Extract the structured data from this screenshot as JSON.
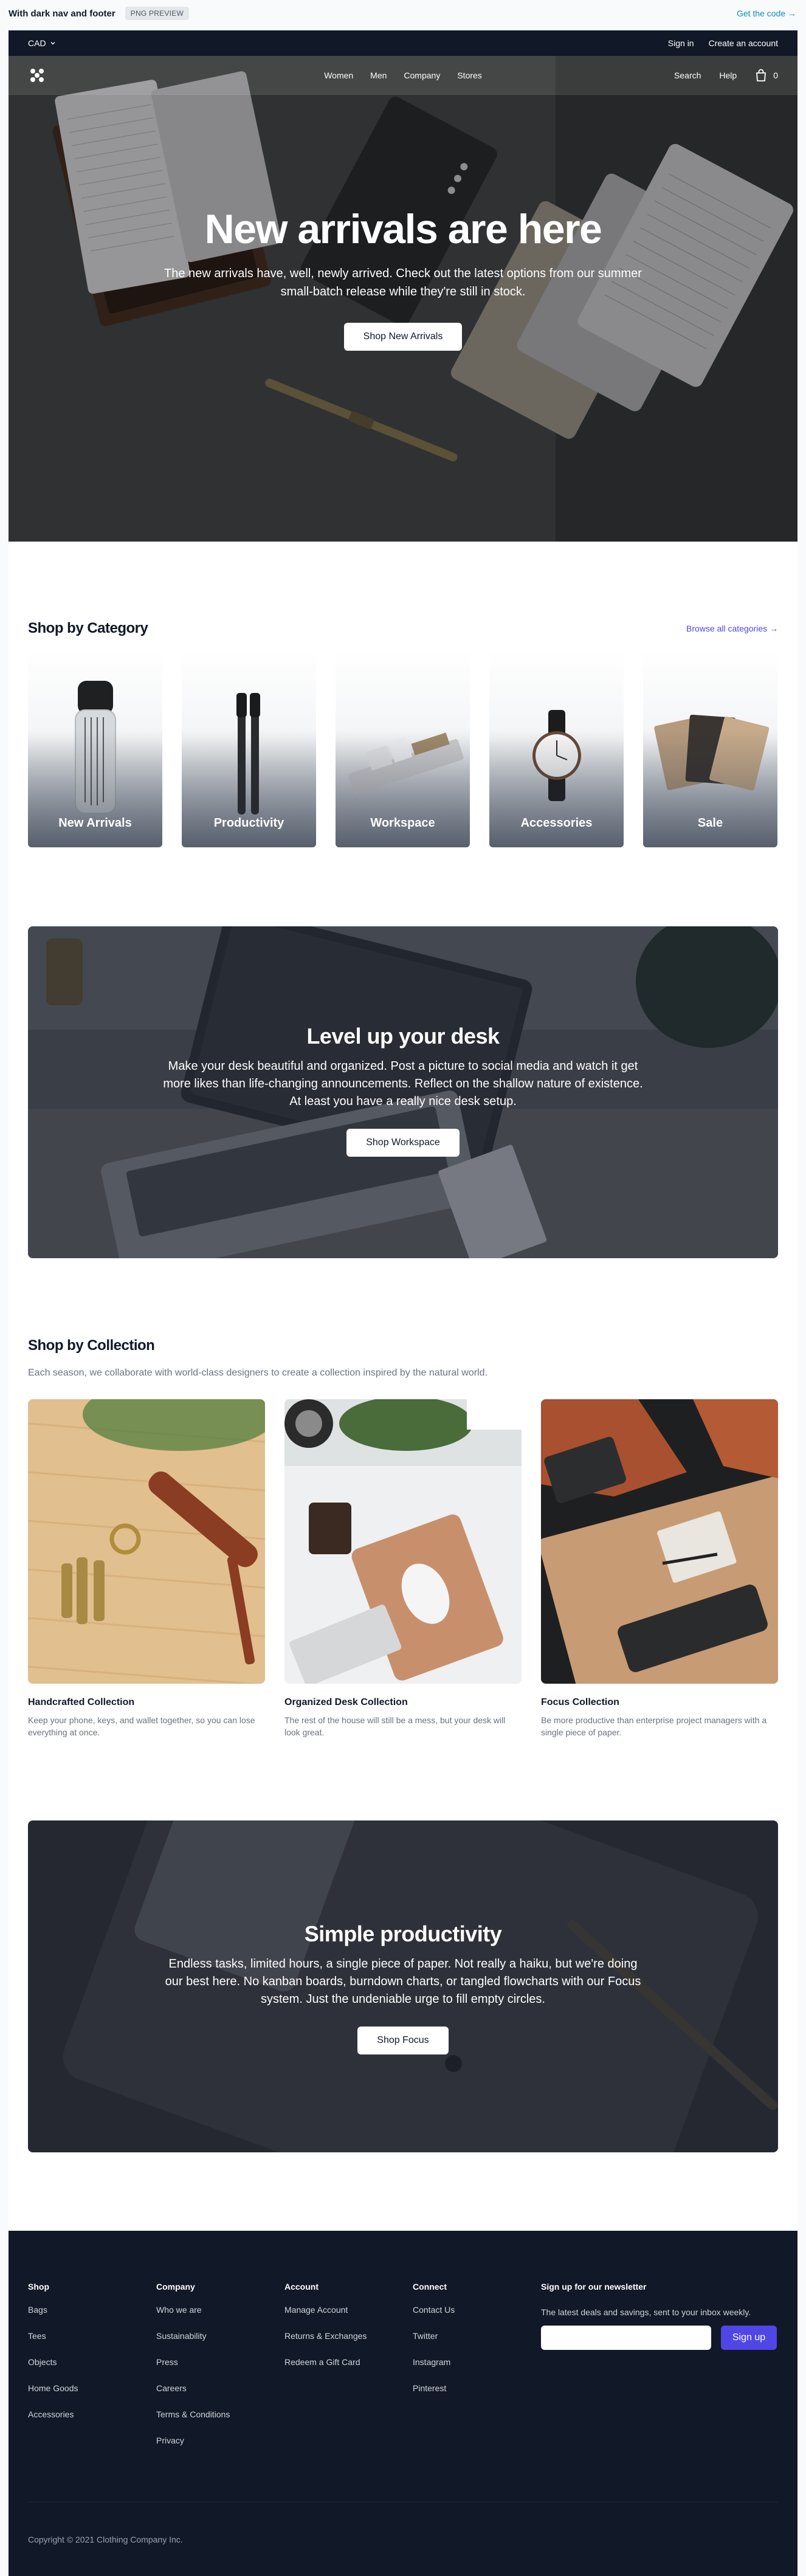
{
  "preview": {
    "title": "With dark nav and footer",
    "badge": "PNG PREVIEW",
    "get_code": "Get the code →"
  },
  "topbar": {
    "currency": "CAD",
    "sign_in": "Sign in",
    "create_account": "Create an account"
  },
  "nav": {
    "links": [
      "Women",
      "Men",
      "Company",
      "Stores"
    ],
    "search": "Search",
    "help": "Help",
    "cart_count": "0"
  },
  "hero": {
    "title": "New arrivals are here",
    "subtitle": "The new arrivals have, well, newly arrived. Check out the latest options from our summer small-batch release while they're still in stock.",
    "cta": "Shop New Arrivals"
  },
  "categories": {
    "heading": "Shop by Category",
    "browse": "Browse all categories →",
    "items": [
      "New Arrivals",
      "Productivity",
      "Workspace",
      "Accessories",
      "Sale"
    ]
  },
  "desk_banner": {
    "title": "Level up your desk",
    "text": "Make your desk beautiful and organized. Post a picture to social media and watch it get more likes than life-changing announcements. Reflect on the shallow nature of existence. At least you have a really nice desk setup.",
    "cta": "Shop Workspace"
  },
  "collections": {
    "heading": "Shop by Collection",
    "subtitle": "Each season, we collaborate with world-class designers to create a collection inspired by the natural world.",
    "items": [
      {
        "name": "Handcrafted Collection",
        "desc": "Keep your phone, keys, and wallet together, so you can lose everything at once."
      },
      {
        "name": "Organized Desk Collection",
        "desc": "The rest of the house will still be a mess, but your desk will look great."
      },
      {
        "name": "Focus Collection",
        "desc": "Be more productive than enterprise project managers with a single piece of paper."
      }
    ]
  },
  "focus_banner": {
    "title": "Simple productivity",
    "text": "Endless tasks, limited hours, a single piece of paper. Not really a haiku, but we're doing our best here. No kanban boards, burndown charts, or tangled flowcharts with our Focus system. Just the undeniable urge to fill empty circles.",
    "cta": "Shop Focus"
  },
  "footer": {
    "shop": {
      "heading": "Shop",
      "links": [
        "Bags",
        "Tees",
        "Objects",
        "Home Goods",
        "Accessories"
      ]
    },
    "company": {
      "heading": "Company",
      "links": [
        "Who we are",
        "Sustainability",
        "Press",
        "Careers",
        "Terms & Conditions",
        "Privacy"
      ]
    },
    "account": {
      "heading": "Account",
      "links": [
        "Manage Account",
        "Returns & Exchanges",
        "Redeem a Gift Card"
      ]
    },
    "connect": {
      "heading": "Connect",
      "links": [
        "Contact Us",
        "Twitter",
        "Instagram",
        "Pinterest"
      ]
    },
    "newsletter": {
      "heading": "Sign up for our newsletter",
      "text": "The latest deals and savings, sent to your inbox weekly.",
      "placeholder": "",
      "button": "Sign up"
    },
    "copyright": "Copyright © 2021 Clothing Company Inc."
  },
  "colors": {
    "dark": "#111827",
    "accent": "#4f46e5",
    "link": "#0891b2"
  }
}
